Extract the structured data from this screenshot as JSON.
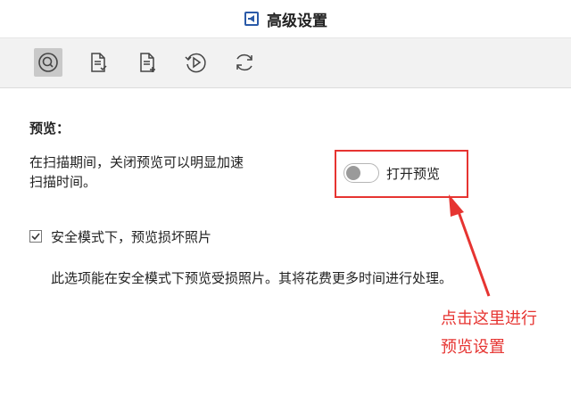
{
  "window": {
    "title": "高级设置"
  },
  "toolbar": {
    "tools": [
      {
        "icon": "preview-scan-icon",
        "active": true
      },
      {
        "icon": "file-check-icon",
        "active": false
      },
      {
        "icon": "file-add-icon",
        "active": false
      },
      {
        "icon": "play-recover-icon",
        "active": false
      },
      {
        "icon": "refresh-icon",
        "active": false
      }
    ]
  },
  "preview": {
    "section_title": "预览：",
    "description_line1": "在扫描期间，关闭预览可以明显加速",
    "description_line2": "扫描时间。",
    "toggle_label": "打开预览",
    "toggle_on": false,
    "safe_mode_label": "安全模式下，预览损坏照片",
    "safe_mode_checked": true,
    "safe_mode_note": "此选项能在安全模式下预览受损照片。其将花费更多时间进行处理。"
  },
  "annotation": {
    "line1": "点击这里进行",
    "line2": "预览设置",
    "color": "#e63431"
  }
}
